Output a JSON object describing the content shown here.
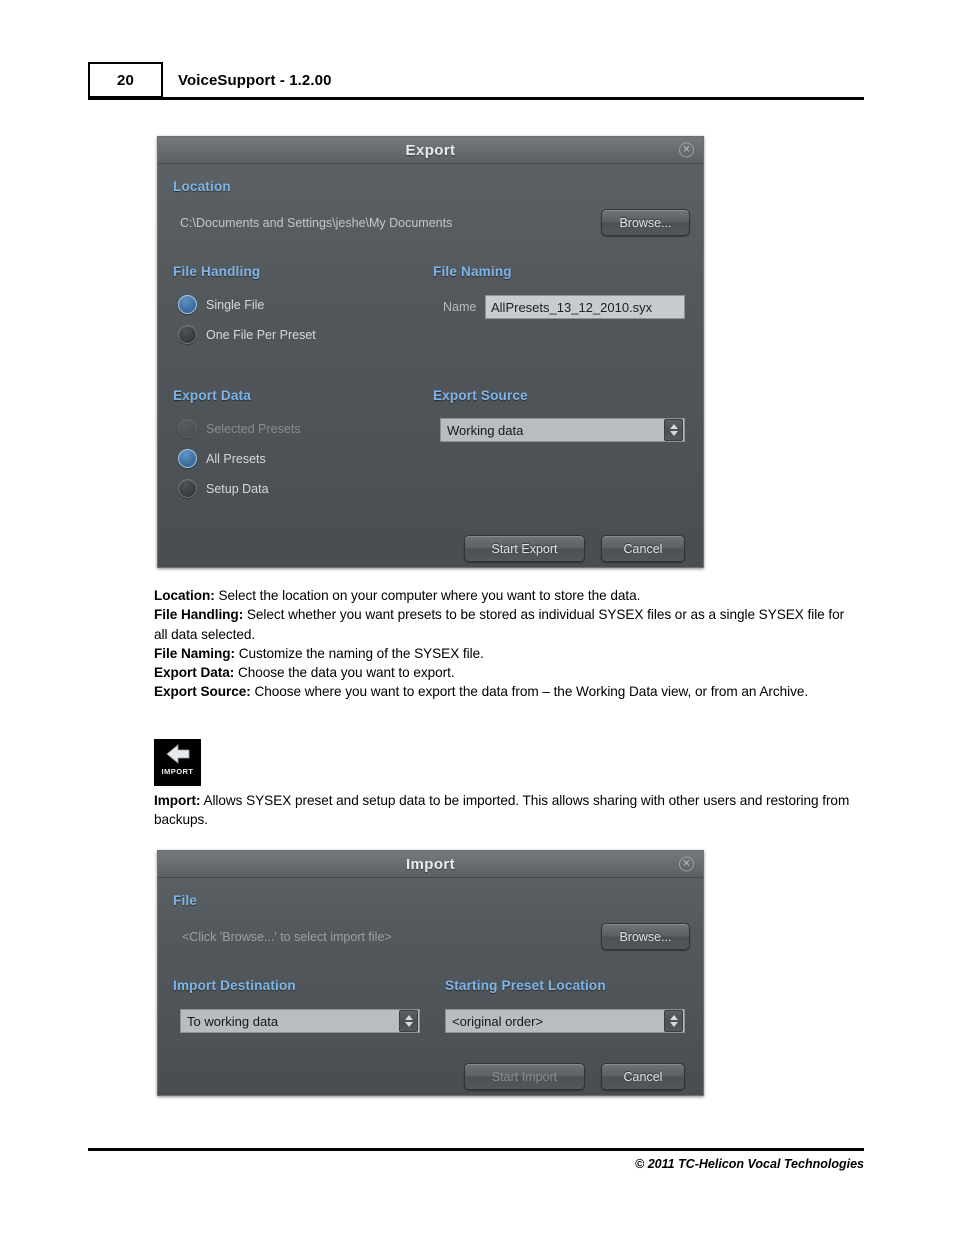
{
  "header": {
    "page_number": "20",
    "title": "VoiceSupport - 1.2.00"
  },
  "export_dialog": {
    "title": "Export",
    "close_icon": "close-circle-icon",
    "location": {
      "label": "Location",
      "path": "C:\\Documents and Settings\\jeshe\\My Documents",
      "browse_label": "Browse..."
    },
    "file_handling": {
      "label": "File Handling",
      "options": [
        {
          "label": "Single File",
          "selected": true,
          "enabled": true
        },
        {
          "label": "One File Per Preset",
          "selected": false,
          "enabled": true
        }
      ]
    },
    "file_naming": {
      "label": "File Naming",
      "name_caption": "Name",
      "name_value": "AllPresets_13_12_2010.syx"
    },
    "export_data": {
      "label": "Export Data",
      "options": [
        {
          "label": "Selected Presets",
          "selected": false,
          "enabled": false
        },
        {
          "label": "All Presets",
          "selected": true,
          "enabled": true
        },
        {
          "label": "Setup Data",
          "selected": false,
          "enabled": true
        }
      ]
    },
    "export_source": {
      "label": "Export Source",
      "selected": "Working data"
    },
    "buttons": {
      "start_label": "Start Export",
      "cancel_label": "Cancel"
    }
  },
  "export_description": {
    "lines": [
      {
        "term": "Location:",
        "text": " Select the location on your computer where you want to store the data."
      },
      {
        "term": "File Handling:",
        "text": " Select whether you want presets to be stored as individual SYSEX files or as a single SYSEX file for all data selected."
      },
      {
        "term": "File Naming:",
        "text": " Customize the naming of the SYSEX file."
      },
      {
        "term": "Export Data:",
        "text": " Choose the data you want to export."
      },
      {
        "term": "Export Source:",
        "text": " Choose where you want to export the data from – the Working Data view, or from an Archive."
      }
    ]
  },
  "import_icon": {
    "caption": "IMPORT",
    "glyph": "import-arrow-icon"
  },
  "import_description": {
    "term": "Import:",
    "text": " Allows SYSEX preset and setup data to be imported.  This allows sharing with other users and restoring from backups."
  },
  "import_dialog": {
    "title": "Import",
    "close_icon": "close-circle-icon",
    "file": {
      "label": "File",
      "placeholder_text": "<Click 'Browse...' to select import file>",
      "browse_label": "Browse..."
    },
    "import_destination": {
      "label": "Import Destination",
      "selected": "To working data"
    },
    "starting_preset_location": {
      "label": "Starting Preset Location",
      "selected": "<original order>"
    },
    "buttons": {
      "start_label": "Start Import",
      "start_enabled": false,
      "cancel_label": "Cancel"
    }
  },
  "footer": {
    "copyright": "© 2011 TC-Helicon Vocal Technologies"
  },
  "colors": {
    "section_label": "#7fb5e8",
    "dialog_bg": "#53585c",
    "radio_on": "#3f6f9f"
  }
}
